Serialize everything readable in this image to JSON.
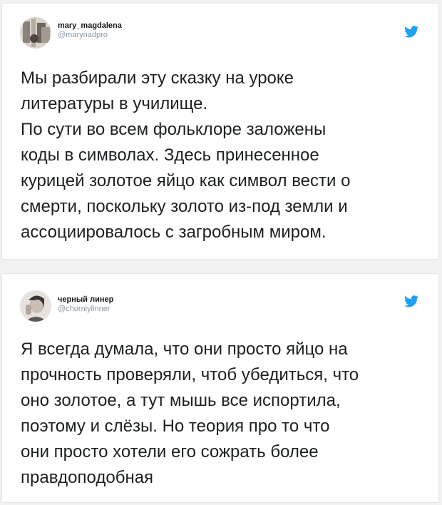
{
  "tweets": [
    {
      "display_name": "mary_magdalena",
      "handle": "@marynadpro",
      "text": "Мы разбирали эту сказку на уроке\nлитературы в училище.\nПо сути во всем фольклоре заложены\nкоды в символах. Здесь принесенное\nкурицей золотое яйцо как символ вести о\nсмерти, поскольку золото из-под земли и\nассоциировалось с загробным миром."
    },
    {
      "display_name": "черный линер",
      "handle": "@chorniylinner",
      "text": "Я всегда думала, что они просто яйцо на\nпрочность проверяли, чтоб убедиться, что\nоно золотое, а тут мышь все испортила,\nпоэтому и слёзы. Но теория про то что\nони просто хотели его сожрать более\nправдоподобная"
    }
  ],
  "icons": {
    "bird": "twitter-bird-icon"
  },
  "colors": {
    "twitter_blue": "#1da1f2",
    "background": "#f1f1f1"
  }
}
